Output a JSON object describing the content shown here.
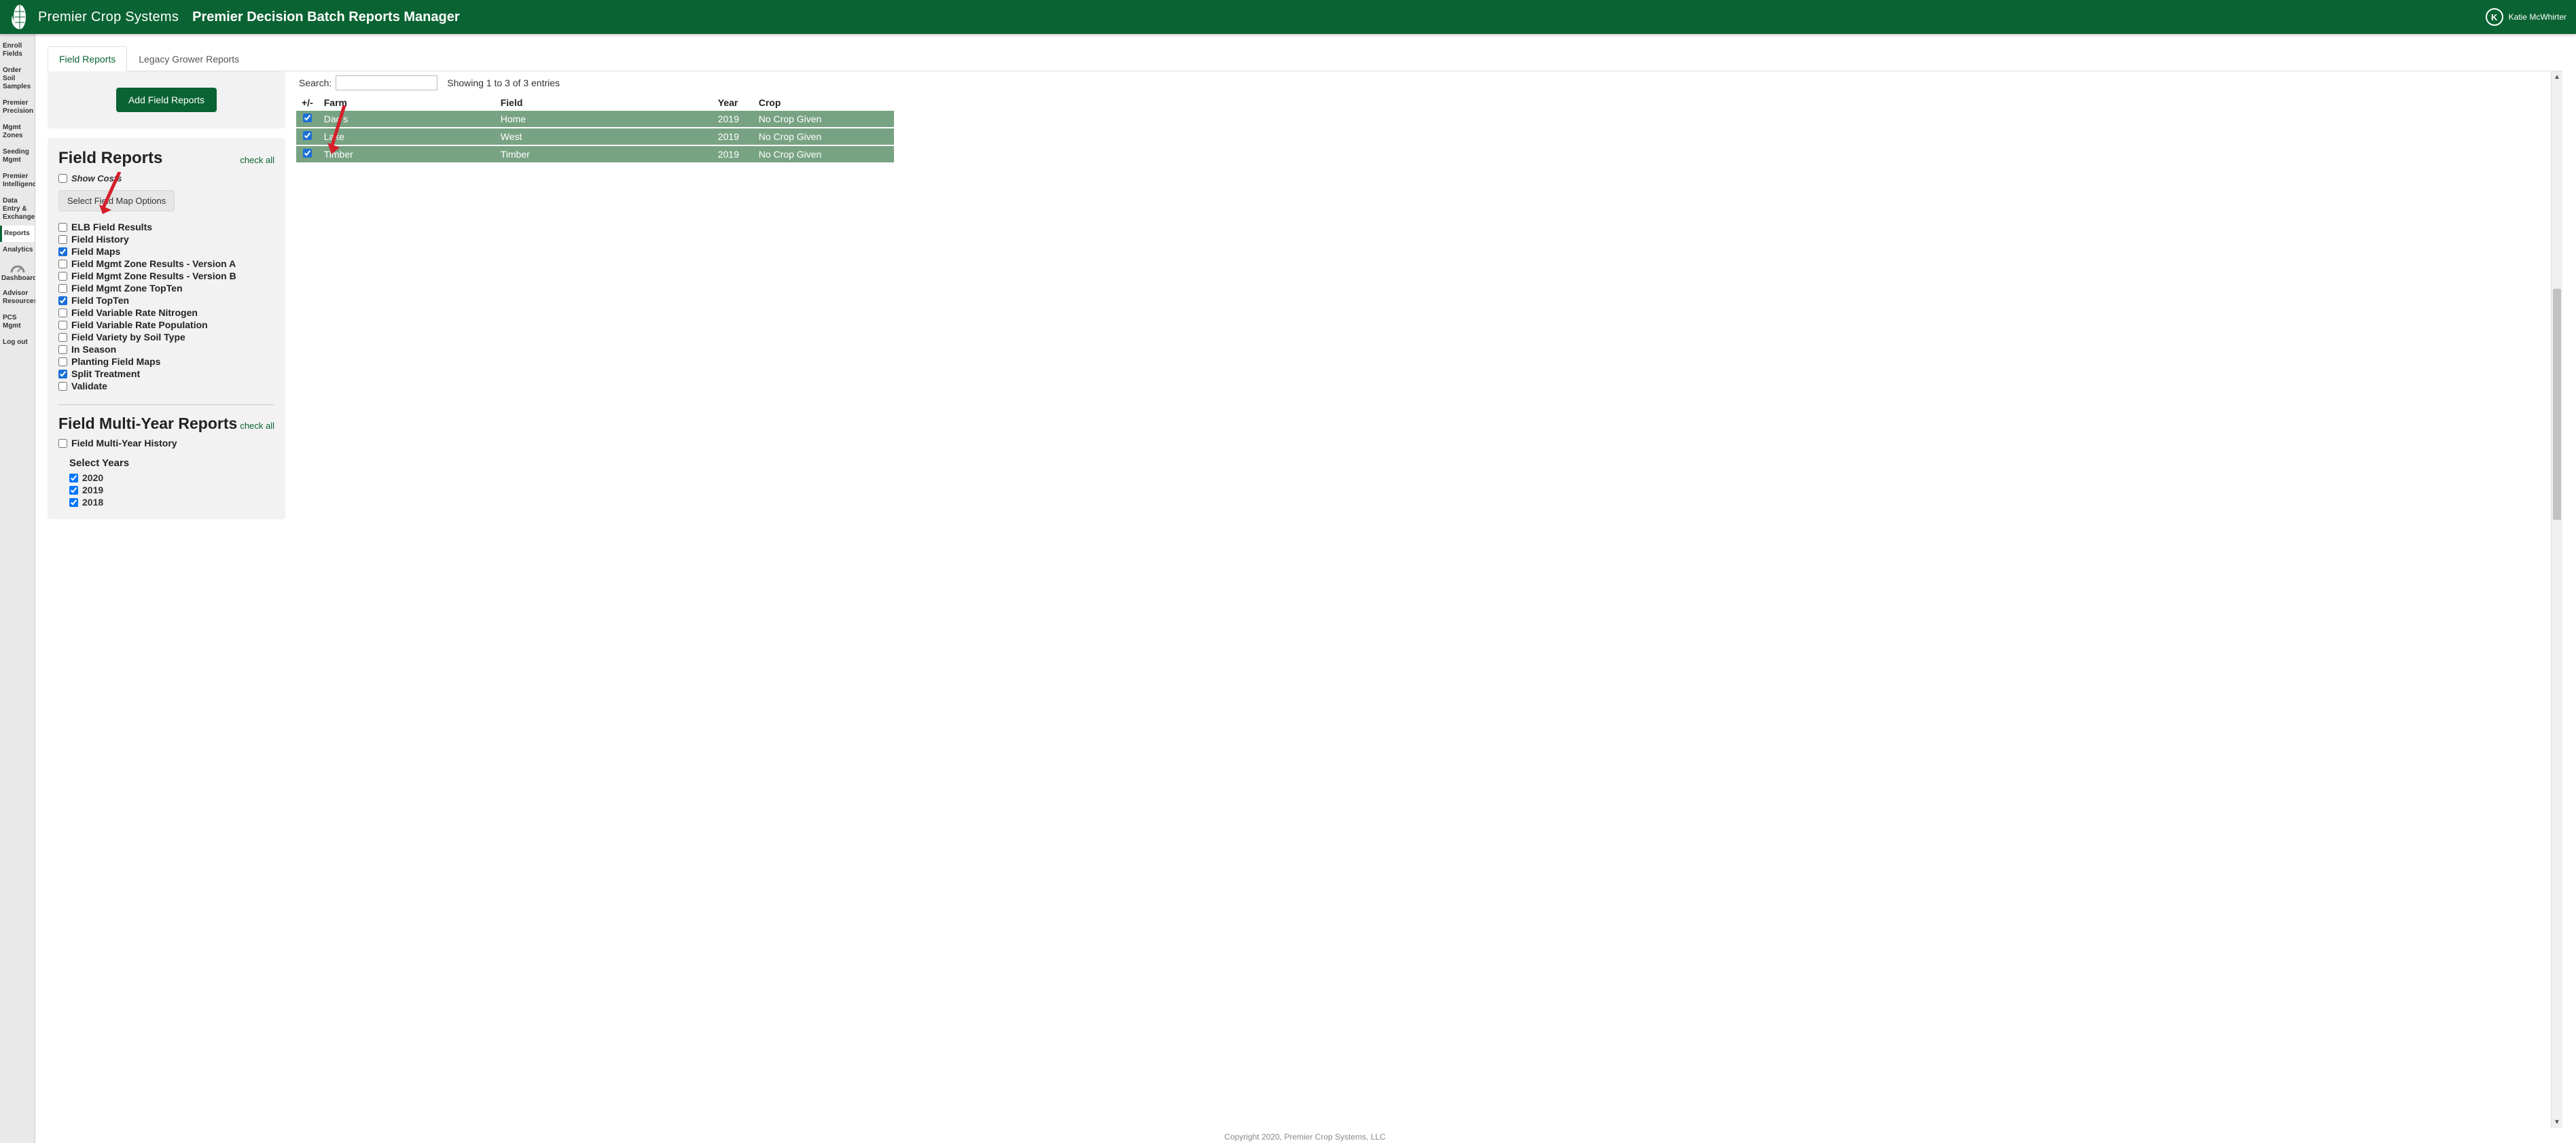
{
  "header": {
    "brand": "Premier Crop Systems",
    "page_title": "Premier Decision Batch Reports Manager",
    "user_initial": "K",
    "user_name": "Katie McWhirter"
  },
  "sidebar": {
    "items": [
      {
        "label": "Enroll Fields"
      },
      {
        "label": "Order Soil Samples"
      },
      {
        "label": "Premier Precision"
      },
      {
        "label": "Mgmt Zones"
      },
      {
        "label": "Seeding Mgmt"
      },
      {
        "label": "Premier Intelligence"
      },
      {
        "label": "Data Entry & Exchange"
      },
      {
        "label": "Reports",
        "active": true
      },
      {
        "label": "Analytics"
      },
      {
        "label": "Dashboards",
        "icon": true
      },
      {
        "label": "Advisor Resources"
      },
      {
        "label": "PCS Mgmt"
      },
      {
        "label": "Log out"
      }
    ]
  },
  "tabs": [
    {
      "label": "Field Reports",
      "active": true
    },
    {
      "label": "Legacy Grower Reports"
    }
  ],
  "left_panel": {
    "add_button": "Add Field Reports",
    "section1_title": "Field Reports",
    "check_all": "check all",
    "show_costs": "Show Costs",
    "map_options_btn": "Select Field Map Options",
    "report_options": [
      {
        "label": "ELB Field Results",
        "checked": false
      },
      {
        "label": "Field History",
        "checked": false
      },
      {
        "label": "Field Maps",
        "checked": true
      },
      {
        "label": "Field Mgmt Zone Results - Version A",
        "checked": false
      },
      {
        "label": "Field Mgmt Zone Results - Version B",
        "checked": false
      },
      {
        "label": "Field Mgmt Zone TopTen",
        "checked": false
      },
      {
        "label": "Field TopTen",
        "checked": true
      },
      {
        "label": "Field Variable Rate Nitrogen",
        "checked": false
      },
      {
        "label": "Field Variable Rate Population",
        "checked": false
      },
      {
        "label": "Field Variety by Soil Type",
        "checked": false
      },
      {
        "label": "In Season",
        "checked": false
      },
      {
        "label": "Planting Field Maps",
        "checked": false
      },
      {
        "label": "Split Treatment",
        "checked": true
      },
      {
        "label": "Validate",
        "checked": false
      }
    ],
    "section2_title": "Field Multi-Year Reports",
    "multi_year_option": {
      "label": "Field Multi-Year History",
      "checked": false
    },
    "select_years_label": "Select Years",
    "years": [
      {
        "label": "2020",
        "checked": true
      },
      {
        "label": "2019",
        "checked": true
      },
      {
        "label": "2018",
        "checked": true
      }
    ]
  },
  "right_panel": {
    "search_label": "Search:",
    "search_value": "",
    "entries_info": "Showing 1 to 3 of 3 entries",
    "columns": {
      "pm": "+/-",
      "farm": "Farm",
      "field": "Field",
      "year": "Year",
      "crop": "Crop"
    },
    "rows": [
      {
        "checked": true,
        "farm": "Dad's",
        "field": "Home",
        "year": "2019",
        "crop": "No Crop Given"
      },
      {
        "checked": true,
        "farm": "Lake",
        "field": "West",
        "year": "2019",
        "crop": "No Crop Given"
      },
      {
        "checked": true,
        "farm": "Timber",
        "field": "Timber",
        "year": "2019",
        "crop": "No Crop Given"
      }
    ]
  },
  "footer": "Copyright 2020, Premier Crop Systems, LLC"
}
